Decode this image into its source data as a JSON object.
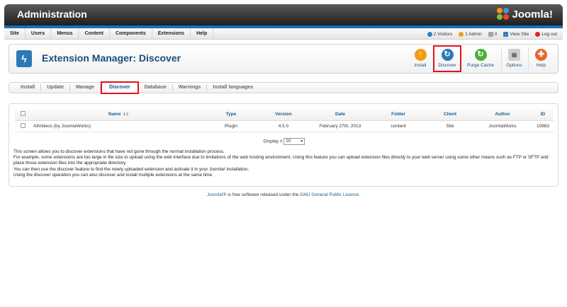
{
  "header": {
    "title": "Administration",
    "logo_text": "Joomla!"
  },
  "menu": {
    "items": [
      "Site",
      "Users",
      "Menus",
      "Content",
      "Components",
      "Extensions",
      "Help"
    ]
  },
  "status": {
    "visitors": "2 Visitors",
    "admin": "1 Admin",
    "messages": "0",
    "view_site": "View Site",
    "logout": "Log out"
  },
  "page": {
    "title": "Extension Manager: Discover"
  },
  "toolbar": {
    "install": "Install",
    "discover": "Discover",
    "purge": "Purge Cache",
    "options": "Options",
    "help": "Help"
  },
  "tabs": [
    "Install",
    "Update",
    "Manage",
    "Discover",
    "Database",
    "Warnings",
    "Install languages"
  ],
  "table": {
    "headers": {
      "name": "Name",
      "type": "Type",
      "version": "Version",
      "date": "Date",
      "folder": "Folder",
      "client": "Client",
      "author": "Author",
      "id": "ID"
    },
    "rows": [
      {
        "name": "AllVideos (by JoomlaWorks)",
        "type": "Plugin",
        "version": "4.5.0",
        "date": "February 27th, 2013",
        "folder": "content",
        "client": "Site",
        "author": "JoomlaWorks",
        "id": "10863"
      }
    ]
  },
  "pager": {
    "label": "Display #",
    "value": "20"
  },
  "info": [
    "This screen allows you to discover extensions that have not gone through the normal installation process.",
    "For example, some extensions are too large in file size to upload using the web interface due to limitations of the web hosting environment. Using this feature you can upload extension files directly to your web server using some other means such as FTP or SFTP and place those extension files into the appropriate directory.",
    "You can then use the discover feature to find the newly uploaded extension and activate it in your Joomla! installation.",
    "Using the discover operation you can also discover and install multiple extensions at the same time."
  ],
  "footer": {
    "brand": "Joomla!®",
    "text": " is free software released under the ",
    "license": "GNU General Public License",
    "end": "."
  },
  "colors": {
    "accent": "#1a70b0",
    "highlight": "#e0141b",
    "install": "#f39c12",
    "discover": "#2b7ab7",
    "purge": "#4caf3a",
    "help": "#e8662a"
  }
}
